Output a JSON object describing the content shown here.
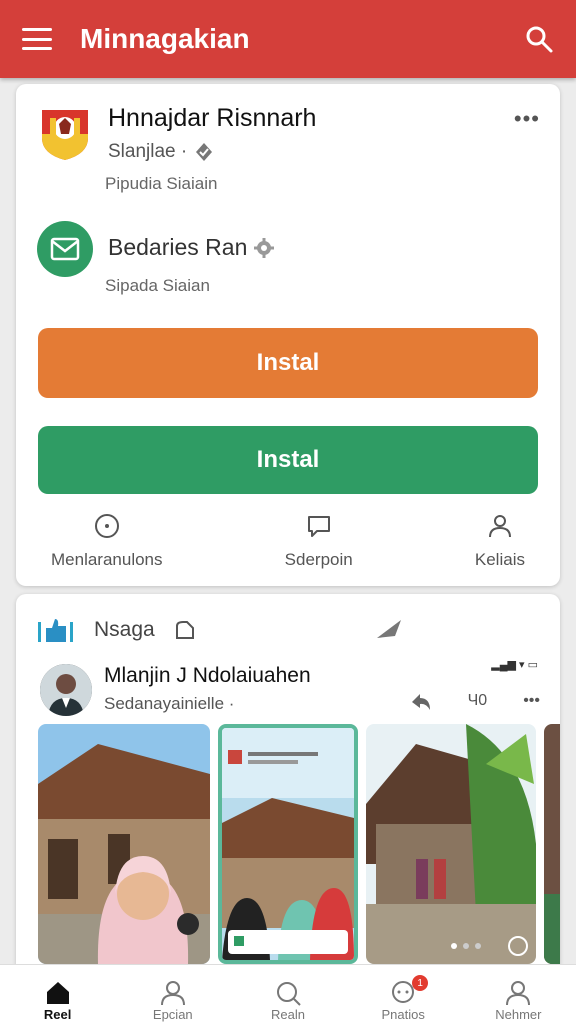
{
  "appbar": {
    "title": "Minnagakian",
    "menu_icon": "menu-icon",
    "search_icon": "search-icon",
    "color": "#d43f3a"
  },
  "card1": {
    "app1": {
      "name": "Hnnajdar Risnnarh",
      "meta": "Slanjlae ·",
      "sub": "Pipudia Siaiain"
    },
    "app2": {
      "name": "Bedaries Ran",
      "sub": "Sipada Siaian"
    },
    "buttons": {
      "orange": "Instal",
      "green": "Instal"
    },
    "actions": [
      {
        "label": "Menlaranulons",
        "icon": "info-icon"
      },
      {
        "label": "Sderpoin",
        "icon": "chat-icon"
      },
      {
        "label": "Keliais",
        "icon": "person-icon"
      }
    ]
  },
  "feed": {
    "title": "Nsaga",
    "post": {
      "name": "Mlanjin J Ndolaiuahen",
      "meta": "Sedanayainielle ·",
      "count": "Ч0"
    }
  },
  "bottom_nav": [
    {
      "label": "Reel",
      "icon": "home-icon",
      "active": true
    },
    {
      "label": "Epcian",
      "icon": "person-icon",
      "active": false
    },
    {
      "label": "Realn",
      "icon": "search-icon",
      "active": false
    },
    {
      "label": "Pnatios",
      "icon": "chat-bubble-icon",
      "active": false,
      "badge": "1"
    },
    {
      "label": "Nehmer",
      "icon": "account-icon",
      "active": false
    }
  ],
  "colors": {
    "orange": "#e47b35",
    "green": "#2f9c64",
    "red": "#d43f3a"
  }
}
